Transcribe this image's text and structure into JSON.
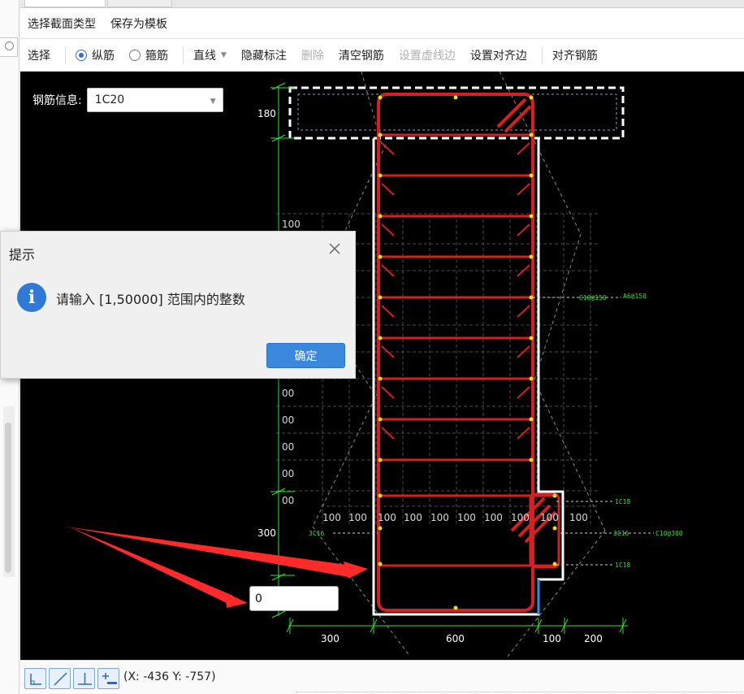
{
  "toolbar": {
    "menu": [
      "选择截面类型",
      "保存为模板"
    ],
    "tools": {
      "select": "选择",
      "longitudinal": "纵筋",
      "stirrup": "箍筋",
      "line": "直线",
      "hide_dims": "隐藏标注",
      "delete": "删除",
      "clear_rebar": "清空钢筋",
      "set_dashed_edge": "设置虚线边",
      "set_align_edge": "设置对齐边",
      "align_rebar": "对齐钢筋"
    }
  },
  "canvas": {
    "rebar_info_label": "钢筋信息:",
    "rebar_info_value": "1C20",
    "dim_left_top": "180",
    "dim_left_bottom": "300",
    "dim_bottom": [
      "300",
      "600",
      "100",
      "200"
    ],
    "grid_labels": [
      "100",
      "100",
      "100",
      "100",
      "100",
      "100",
      "100",
      "100",
      "100",
      "100",
      "100"
    ],
    "grid_left_labels": [
      "100",
      "00",
      "00",
      "00",
      "00",
      "00",
      "00"
    ],
    "annotations": {
      "right_mid_a": "C10@150",
      "right_mid_b": "A6@150",
      "right_low_1": "1C18",
      "right_low_2": "3C16",
      "right_low_3": "C10@300",
      "right_low_4": "1C18",
      "left_low": "3C16"
    },
    "input_value": "0"
  },
  "dialog": {
    "title": "提示",
    "message": "请输入 [1,50000] 范围内的整数",
    "ok_label": "确定"
  },
  "status": {
    "coords": "(X: -436 Y: -757)"
  },
  "colors": {
    "rebar": "#d42020",
    "outline": "#ffffff",
    "dimension": "#2fe02f",
    "accent": "#3a87de",
    "arrow": "#ff2a2a"
  }
}
